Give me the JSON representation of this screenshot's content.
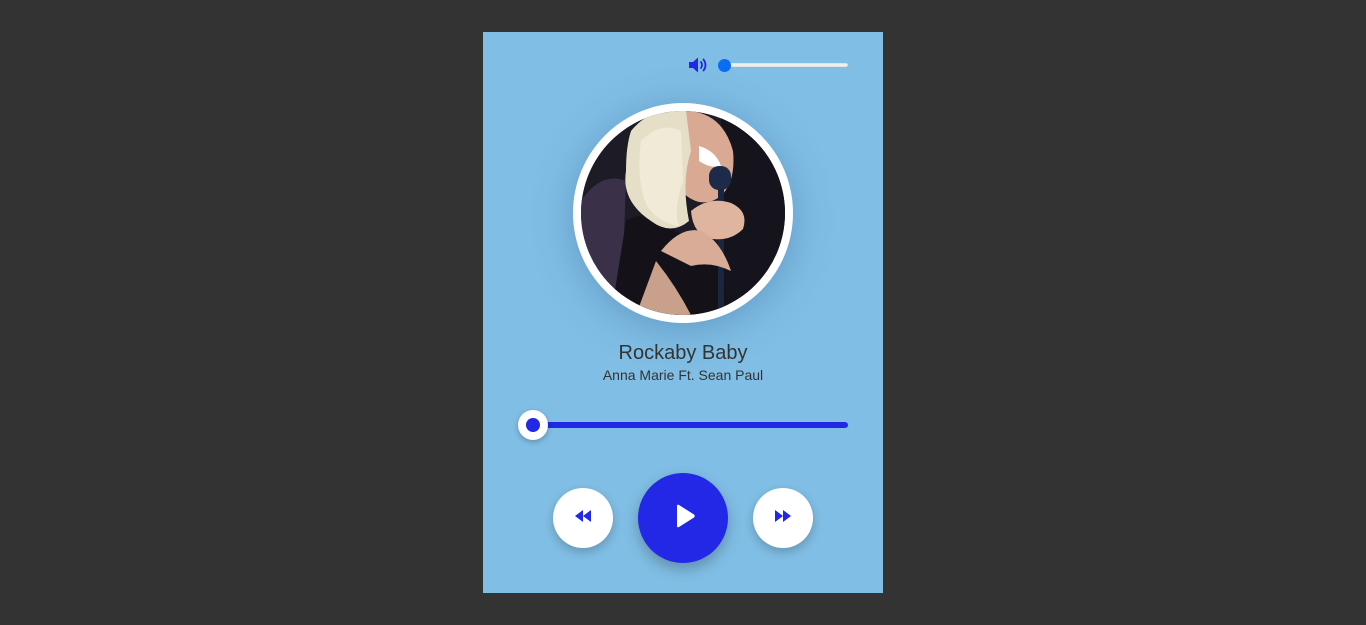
{
  "colors": {
    "page_background": "#333333",
    "player_background": "#81bee5",
    "accent": "#2228e6",
    "volume_accent": "#0a6cf5"
  },
  "volume": {
    "icon": "volume-up-icon",
    "level": 0.0
  },
  "album_art": {
    "description": "photo"
  },
  "track": {
    "title": "Rockaby Baby",
    "artist": "Anna Marie Ft. Sean Paul",
    "progress": 0.0
  },
  "controls": {
    "previous_icon": "rewind-icon",
    "play_icon": "play-icon",
    "next_icon": "fast-forward-icon"
  }
}
